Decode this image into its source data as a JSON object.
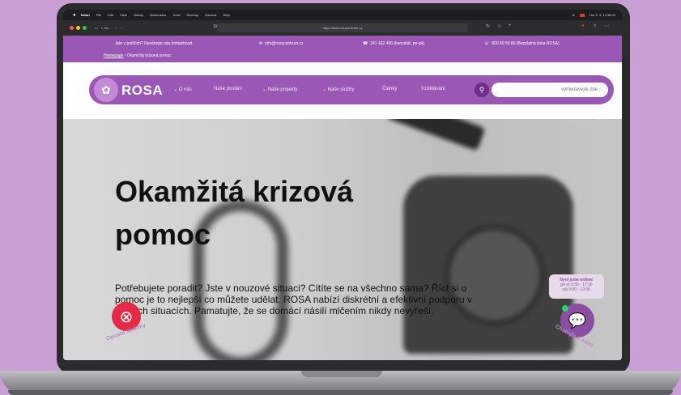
{
  "colors": {
    "brand": "#9b57b5",
    "brand_dark": "#6e2e88",
    "exit": "#e32b47",
    "online": "#2ed06e"
  },
  "menubar": {
    "app": "Safari",
    "items": [
      "File",
      "Edit",
      "View",
      "History",
      "Bookmarks",
      "Tools",
      "Develop",
      "Window",
      "Help"
    ],
    "clock": "Tue 4. 4. 13:38:00"
  },
  "browser": {
    "tab_count": "1 Tab",
    "url": "https://www.rosacentrum.cz"
  },
  "infobar": {
    "help_text": "Jste v potížích? Neváhejte nás kontaktovat.",
    "email": "info@rosacentrum.cz",
    "phone_office": "241 432 466 (kancelář, po-pá)",
    "phone_line": "800 60 50 80 (Bezplatná linka ROSA)",
    "breadcrumb_home": "Homepage",
    "breadcrumb_sep": "›",
    "breadcrumb_current": "Okamžitá krizová pomoc"
  },
  "nav": {
    "logo": "ROSA",
    "items": [
      "⌄ O nás",
      "Naše poslání",
      "⌄ Naše projekty",
      "⌄ Naše služby",
      "Články",
      "Vzdělávání"
    ],
    "search_placeholder": "vyhledávejte zde..."
  },
  "hero": {
    "title": "Okamžitá krizová pomoc",
    "text": "Potřebujete poradit? Jste v nouzové situaci? Cítíte se na všechno sama? Říct si o pomoc je to nejlepší co můžete udělat. ROSA nabízí diskrétní a efektivní podporu v těžkých situacích. Pamatujte, že se domácí násilí mlčením nikdy nevyřeší."
  },
  "widgets": {
    "exit_label": "Opustit stránky",
    "online_title": "Nyní jsme online!",
    "online_hours_1": "po-st 9:30 - 17:30",
    "online_hours_2": "pá 9:30 - 12:00",
    "chat_label": "Chatujte s námi"
  }
}
